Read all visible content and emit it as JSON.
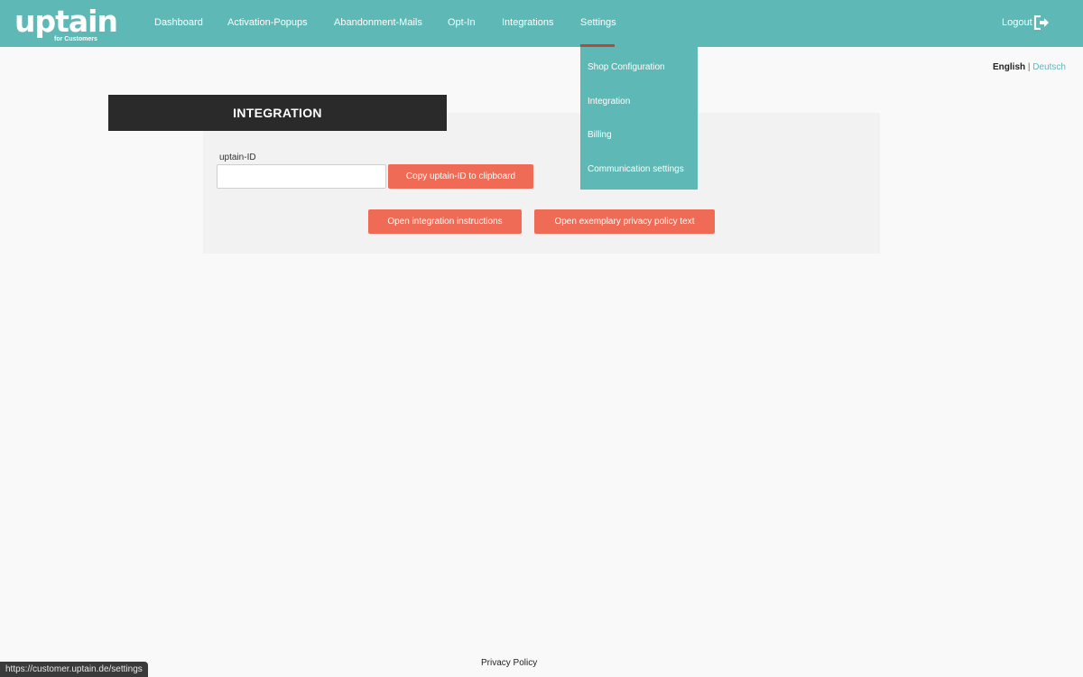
{
  "header": {
    "logo_text": "uptain",
    "logo_sub": "for Customers",
    "nav": [
      {
        "label": "Dashboard"
      },
      {
        "label": "Activation-Popups"
      },
      {
        "label": "Abandonment-Mails"
      },
      {
        "label": "Opt-In"
      },
      {
        "label": "Integrations"
      },
      {
        "label": "Settings",
        "active": true
      }
    ],
    "logout_label": "Logout"
  },
  "settings_menu": {
    "items": [
      {
        "label": "Shop Configuration"
      },
      {
        "label": "Integration"
      },
      {
        "label": "Billing"
      },
      {
        "label": "Communication settings"
      }
    ]
  },
  "language": {
    "current": "English",
    "separator": "|",
    "other": "Deutsch"
  },
  "main": {
    "heading": "INTEGRATION",
    "id_label": "uptain-ID",
    "id_value": "",
    "copy_button": "Copy uptain-ID to clipboard",
    "instructions_button": "Open integration instructions",
    "privacy_button": "Open exemplary privacy policy text"
  },
  "footer": {
    "privacy_link": "Privacy Policy"
  },
  "status_bar": {
    "url": "https://customer.uptain.de/settings"
  },
  "colors": {
    "brand": "#5eb8b5",
    "accent_button": "#ef6b55",
    "active_underline": "#b8473a",
    "heading_bg": "#2a2a2a"
  }
}
